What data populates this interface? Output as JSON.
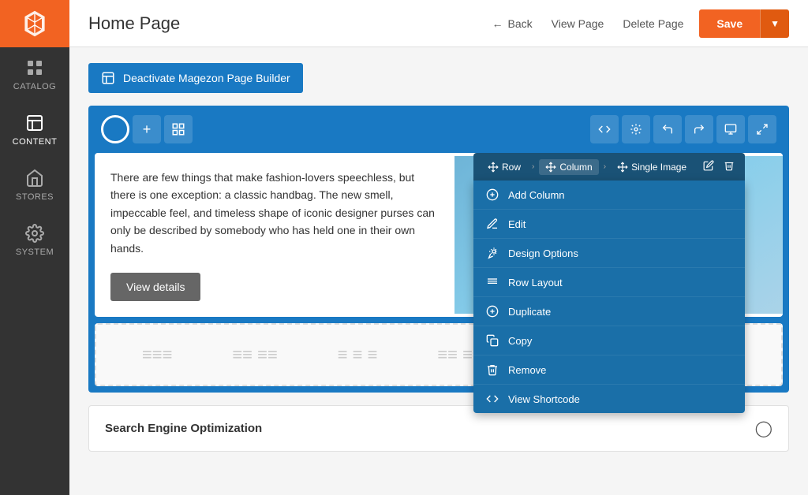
{
  "sidebar": {
    "logo_alt": "Magento Logo",
    "items": [
      {
        "id": "catalog",
        "label": "CATALOG",
        "active": false
      },
      {
        "id": "content",
        "label": "CONTENT",
        "active": true
      },
      {
        "id": "stores",
        "label": "STORES",
        "active": false
      },
      {
        "id": "system",
        "label": "SYSTEM",
        "active": false
      }
    ]
  },
  "topbar": {
    "title": "Home Page",
    "back_label": "Back",
    "view_page_label": "View Page",
    "delete_page_label": "Delete Page",
    "save_label": "Save"
  },
  "deactivate_banner": {
    "label": "Deactivate Magezon Page Builder"
  },
  "builder": {
    "toolbar_buttons": [
      "circle",
      "plus",
      "grid"
    ],
    "right_buttons": [
      "code",
      "gear",
      "undo",
      "redo",
      "desktop",
      "expand"
    ],
    "context_breadcrumb": {
      "row_label": "Row",
      "column_label": "Column",
      "single_image_label": "Single Image"
    },
    "context_menu": [
      {
        "id": "add-column",
        "icon": "plus",
        "label": "Add Column"
      },
      {
        "id": "edit",
        "icon": "pencil",
        "label": "Edit"
      },
      {
        "id": "design-options",
        "icon": "wand",
        "label": "Design Options"
      },
      {
        "id": "row-layout",
        "icon": "rows",
        "label": "Row Layout"
      },
      {
        "id": "duplicate",
        "icon": "copy-circle",
        "label": "Duplicate"
      },
      {
        "id": "copy",
        "icon": "copy",
        "label": "Copy"
      },
      {
        "id": "remove",
        "icon": "trash",
        "label": "Remove"
      },
      {
        "id": "view-shortcode",
        "icon": "code",
        "label": "View Shortcode"
      }
    ],
    "text_content": "There are few things that make fashion-lovers speechless, but there is one exception: a classic handbag. The new smell, impeccable feel, and timeless shape of iconic designer purses can only be described by somebody who has held one in their own hands.",
    "view_details_label": "View details"
  },
  "seo": {
    "title": "Search Engine Optimization"
  }
}
